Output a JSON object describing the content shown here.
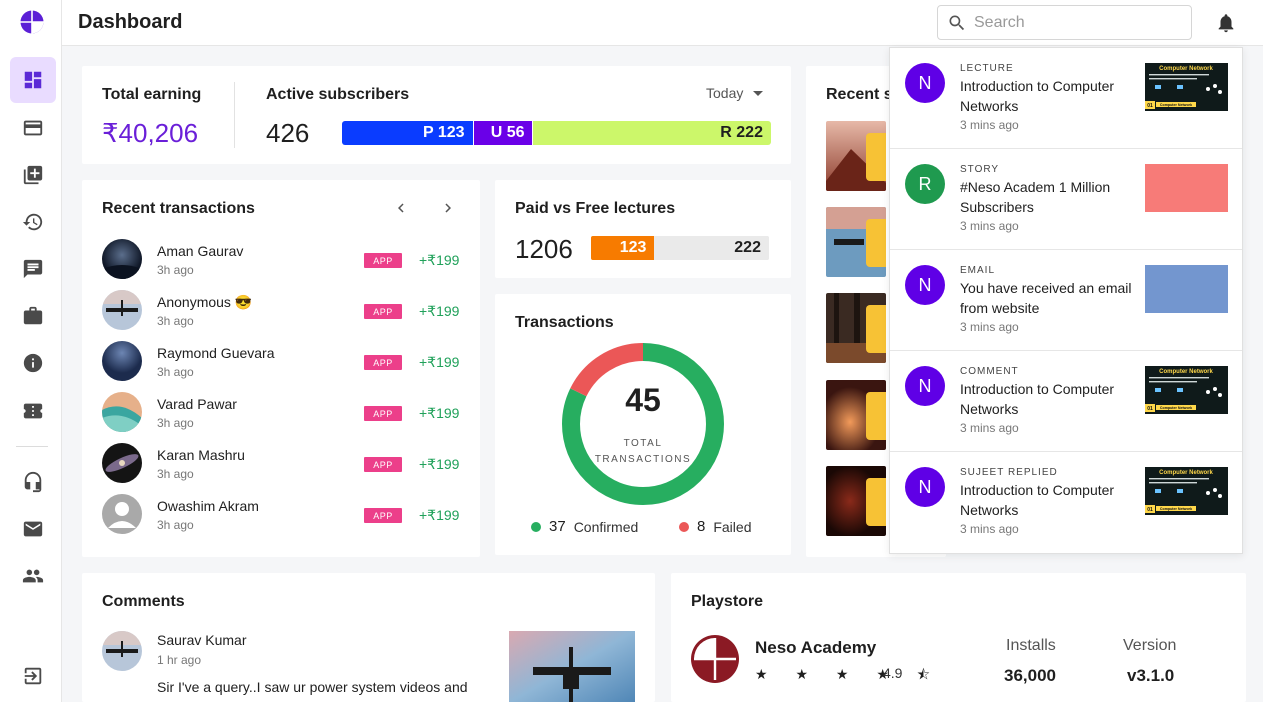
{
  "header": {
    "title": "Dashboard",
    "search_placeholder": "Search"
  },
  "sidebar": {
    "items": [
      {
        "name": "dashboard",
        "icon": "dashboard-icon",
        "active": true
      },
      {
        "name": "payments",
        "icon": "card-icon"
      },
      {
        "name": "add-content",
        "icon": "library-add-icon"
      },
      {
        "name": "history",
        "icon": "history-icon"
      },
      {
        "name": "messages",
        "icon": "chat-icon"
      },
      {
        "name": "work",
        "icon": "briefcase-icon"
      },
      {
        "name": "info",
        "icon": "info-icon"
      },
      {
        "name": "tickets",
        "icon": "ticket-icon"
      },
      {
        "name": "support",
        "icon": "headset-icon"
      },
      {
        "name": "mail",
        "icon": "mail-icon"
      },
      {
        "name": "people",
        "icon": "people-icon"
      },
      {
        "name": "logout",
        "icon": "logout-icon"
      }
    ]
  },
  "earnings": {
    "total_label": "Total earning",
    "total_value": "₹40,206",
    "subs_label": "Active subscribers",
    "subs_value": "426",
    "period": "Today",
    "breakdown": [
      {
        "label": "P 123",
        "value": 123,
        "color": "#0a3cff",
        "text_color": "#ffffff"
      },
      {
        "label": "U 56",
        "value": 56,
        "color": "#6a00e8",
        "text_color": "#ffffff"
      },
      {
        "label": "R 222",
        "value": 222,
        "color": "#ccf76a",
        "text_color": "#1f1f1f"
      }
    ]
  },
  "transactions_list": {
    "title": "Recent transactions",
    "badge": "APP",
    "rows": [
      {
        "name": "Aman Gaurav",
        "time": "3h ago",
        "amount": "+₹199",
        "avatar": "space"
      },
      {
        "name": "Anonymous 😎",
        "time": "3h ago",
        "amount": "+₹199",
        "avatar": "satellite"
      },
      {
        "name": "Raymond Guevara",
        "time": "3h ago",
        "amount": "+₹199",
        "avatar": "night"
      },
      {
        "name": "Varad Pawar",
        "time": "3h ago",
        "amount": "+₹199",
        "avatar": "beach"
      },
      {
        "name": "Karan Mashru",
        "time": "3h ago",
        "amount": "+₹199",
        "avatar": "galaxy"
      },
      {
        "name": "Owashim Akram",
        "time": "3h ago",
        "amount": "+₹199",
        "avatar": "default"
      }
    ]
  },
  "paid_free": {
    "title": "Paid vs Free lectures",
    "total": "1206",
    "paid": {
      "label": "123",
      "value": 123,
      "color": "#f77b00"
    },
    "free": {
      "label": "222",
      "value": 222,
      "color": "#eaeaea"
    }
  },
  "transactions_donut": {
    "title": "Transactions",
    "total": "45",
    "total_label": "TOTAL TRANSACTIONS",
    "confirmed": {
      "count": "37",
      "label": "Confirmed",
      "color": "#27ae60"
    },
    "failed": {
      "count": "8",
      "label": "Failed",
      "color": "#eb5757"
    }
  },
  "stories": {
    "title": "Recent s"
  },
  "notifications": [
    {
      "initial": "N",
      "type": "LECTURE",
      "text": "Introduction to Computer Networks",
      "time": "3 mins ago",
      "avatar_color": "#5f00e6",
      "thumb": "network"
    },
    {
      "initial": "R",
      "type": "STORY",
      "text": "#Neso Academ 1 Million Subscribers",
      "time": "3 mins ago",
      "avatar_color": "#1f9a4f",
      "thumb": "#f77b78"
    },
    {
      "initial": "N",
      "type": "EMAIL",
      "text": "You have received an email from website",
      "time": "3 mins ago",
      "avatar_color": "#5f00e6",
      "thumb": "#7396cf"
    },
    {
      "initial": "N",
      "type": "COMMENT",
      "text": "Introduction to Computer Networks",
      "time": "3 mins ago",
      "avatar_color": "#5f00e6",
      "thumb": "network"
    },
    {
      "initial": "N",
      "type": "SUJEET REPLIED",
      "text": "Introduction to Computer Networks",
      "time": "3 mins ago",
      "avatar_color": "#5f00e6",
      "thumb": "network"
    }
  ],
  "thumb_text": {
    "title": "Computer Network",
    "tag": "Computer Network",
    "num": "01"
  },
  "comments": {
    "title": "Comments",
    "items": [
      {
        "name": "Saurav Kumar",
        "time": "1 hr ago",
        "text": "Sir I've a query..I saw ur power system videos and"
      }
    ]
  },
  "playstore": {
    "title": "Playstore",
    "app_name": "Neso Academy",
    "stars": "★ ★ ★ ★ ⯪",
    "rating": "4.9",
    "installs_label": "Installs",
    "installs_value": "36,000",
    "version_label": "Version",
    "version_value": "v3.1.0"
  },
  "colors": {
    "accent": "#6a1fd8",
    "success": "#20a15a",
    "badge": "#ec3f8a"
  }
}
